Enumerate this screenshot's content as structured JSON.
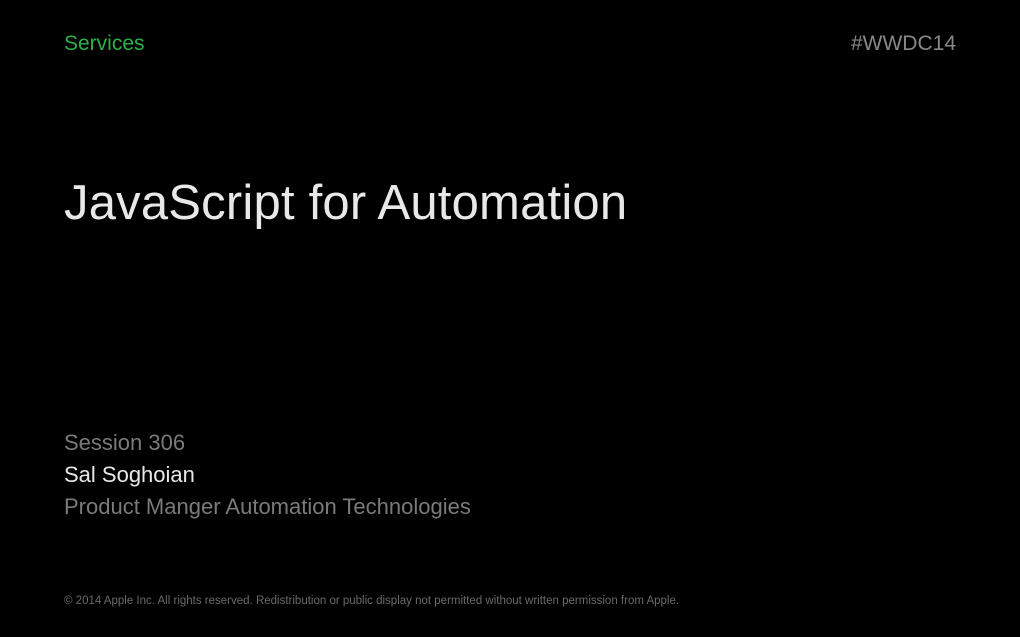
{
  "header": {
    "category": "Services",
    "hashtag": "#WWDC14"
  },
  "title": "JavaScript for Automation",
  "session": {
    "number": "Session 306",
    "speaker": "Sal Soghoian",
    "role": "Product Manger Automation Technologies"
  },
  "copyright": "© 2014 Apple Inc. All rights reserved. Redistribution or public display not permitted without written permission from Apple."
}
